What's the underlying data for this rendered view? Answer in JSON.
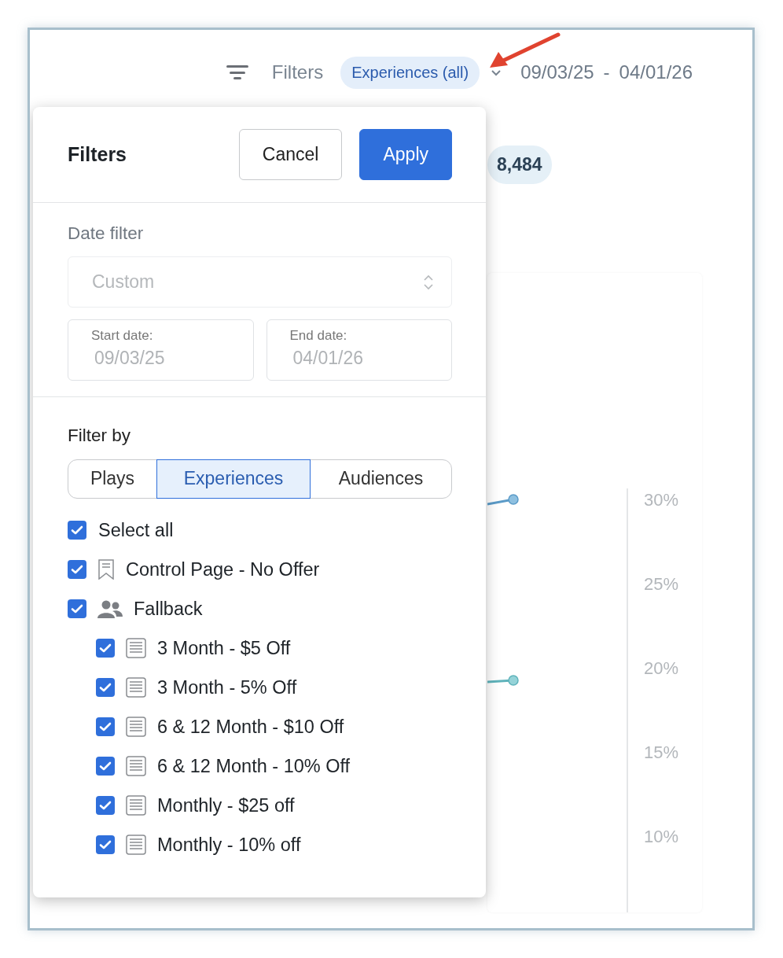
{
  "toolbar": {
    "filters_label": "Filters",
    "active_filter": "Experiences (all)",
    "start_date": "09/03/25",
    "date_separator": "-",
    "end_date": "04/01/26"
  },
  "summary": {
    "count": "8,484"
  },
  "chart": {
    "axis_labels": [
      "30%",
      "25%",
      "20%",
      "15%",
      "10%"
    ]
  },
  "filters_panel": {
    "title": "Filters",
    "buttons": [
      {
        "label": "Cancel",
        "kind": "secondary"
      },
      {
        "label": "Apply",
        "kind": "primary"
      }
    ],
    "date_filter": {
      "label": "Date filter",
      "mode": {
        "value": "Custom",
        "disabled": true
      },
      "start": {
        "label": "Start date:",
        "value": "09/03/25"
      },
      "end": {
        "label": "End date:",
        "value": "04/01/26"
      }
    },
    "filter_by": {
      "label": "Filter by",
      "tabs": [
        {
          "label": "Plays",
          "selected": false
        },
        {
          "label": "Experiences",
          "selected": true
        },
        {
          "label": "Audiences",
          "selected": false
        }
      ],
      "options": [
        {
          "label": "Select all",
          "checked": true,
          "kind": "all"
        },
        {
          "label": "Control Page - No Offer",
          "checked": true,
          "kind": "page"
        },
        {
          "label": "Fallback",
          "checked": true,
          "kind": "group",
          "children": [
            {
              "label": "3 Month - $5 Off",
              "checked": true,
              "kind": "offer"
            },
            {
              "label": "3 Month - 5% Off",
              "checked": true,
              "kind": "offer"
            },
            {
              "label": "6 & 12 Month - $10 Off",
              "checked": true,
              "kind": "offer"
            },
            {
              "label": "6 & 12 Month - 10% Off",
              "checked": true,
              "kind": "offer"
            },
            {
              "label": "Monthly - $25 off",
              "checked": true,
              "kind": "offer"
            },
            {
              "label": "Monthly - 10% off",
              "checked": true,
              "kind": "offer"
            }
          ]
        }
      ]
    }
  }
}
